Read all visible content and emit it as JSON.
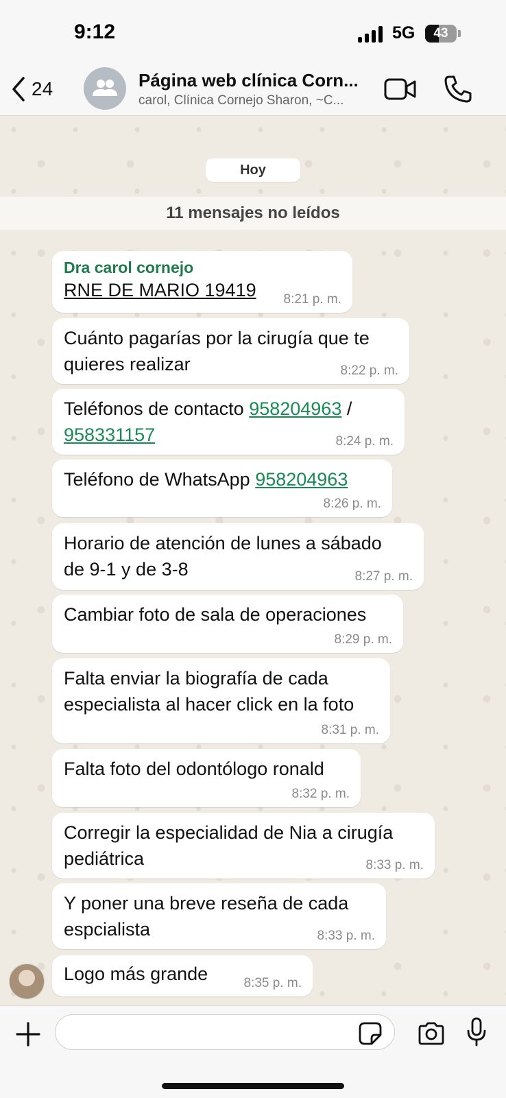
{
  "status_bar": {
    "time": "9:12",
    "network": "5G",
    "battery": "43",
    "battery_level": 0.43
  },
  "header": {
    "back_count": "24",
    "title": "Página web clínica Corn...",
    "subtitle": "carol, Clínica Cornejo Sharon, ~C...",
    "icons": [
      "back-chevron-icon",
      "group-avatar-icon",
      "video-call-icon",
      "phone-call-icon"
    ]
  },
  "chat": {
    "date_chip": "Hoy",
    "unread_banner": "11 mensajes no leídos",
    "messages": [
      {
        "sender": "Dra carol cornejo",
        "text": "RNE DE MARIO 19419",
        "time": "8:21 p. m."
      },
      {
        "line1": "Cuánto pagarías por la cirugía que te",
        "line2": "quieres realizar",
        "time": "8:22 p. m."
      },
      {
        "prefix": "Teléfonos de contacto ",
        "phone1": "958204963",
        "separator": " /",
        "phone2": "958331157",
        "time": "8:24 p. m."
      },
      {
        "prefix": "Teléfono de WhatsApp ",
        "phone": "958204963",
        "time": "8:26 p. m."
      },
      {
        "line1": "Horario de atención de lunes a sábado",
        "line2": "de 9-1 y de 3-8",
        "time": "8:27 p. m."
      },
      {
        "text": "Cambiar foto de sala de operaciones",
        "time": "8:29 p. m."
      },
      {
        "line1": "Falta enviar la biografía de cada",
        "line2": "especialista al hacer click en la foto",
        "time": "8:31 p. m."
      },
      {
        "text": "Falta foto del odontólogo ronald",
        "time": "8:32 p. m."
      },
      {
        "line1": "Corregir la especialidad de Nia a cirugía",
        "line2": "pediátrica",
        "time": "8:33 p. m."
      },
      {
        "line1": "Y poner una breve reseña de cada",
        "line2": "espcialista",
        "time": "8:33 p. m."
      },
      {
        "text": "Logo más grande",
        "time": "8:35 p. m."
      }
    ]
  },
  "composer": {
    "input_value": "",
    "icons": [
      "plus-icon",
      "sticker-icon",
      "camera-icon",
      "microphone-icon"
    ]
  }
}
